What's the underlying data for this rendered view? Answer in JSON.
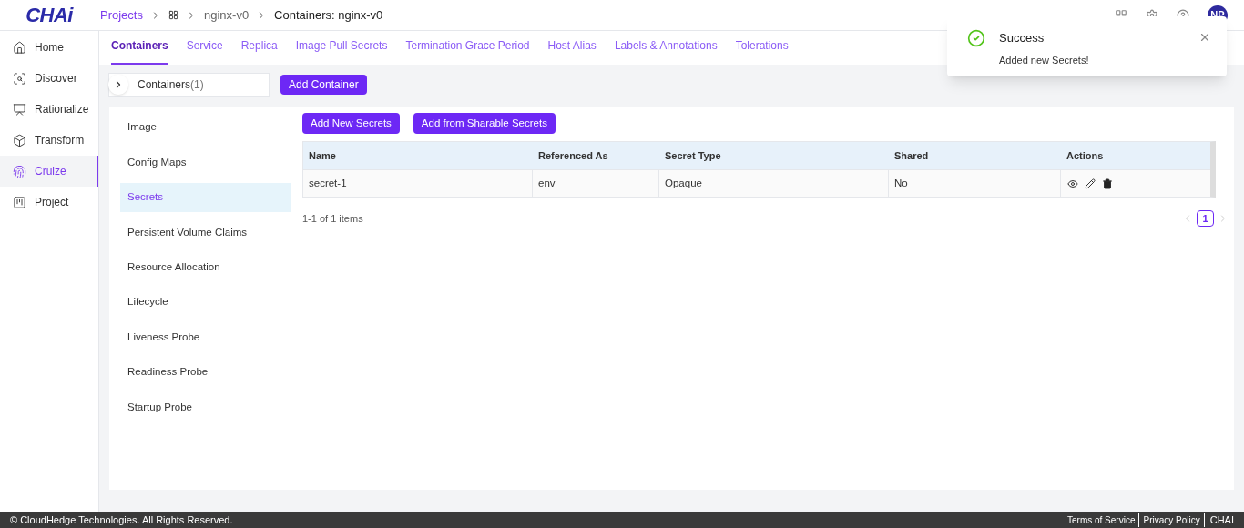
{
  "logo": "CHAi",
  "breadcrumb": [
    {
      "label": "Projects",
      "kind": "link"
    },
    {
      "kind": "grid"
    },
    {
      "label": "nginx-v0",
      "kind": "plain"
    },
    {
      "label": "Containers: nginx-v0",
      "kind": "current"
    }
  ],
  "avatar": "NP",
  "sidebar": [
    {
      "label": "Home",
      "selected": false
    },
    {
      "label": "Discover",
      "selected": false
    },
    {
      "label": "Rationalize",
      "selected": false
    },
    {
      "label": "Transform",
      "selected": false
    },
    {
      "label": "Cruize",
      "selected": true
    },
    {
      "label": "Project",
      "selected": false
    }
  ],
  "tabs": [
    {
      "label": "Containers",
      "selected": true
    },
    {
      "label": "Service",
      "selected": false
    },
    {
      "label": "Replica",
      "selected": false
    },
    {
      "label": "Image Pull Secrets",
      "selected": false
    },
    {
      "label": "Termination Grace Period",
      "selected": false
    },
    {
      "label": "Host Alias",
      "selected": false
    },
    {
      "label": "Labels & Annotations",
      "selected": false
    },
    {
      "label": "Tolerations",
      "selected": false
    }
  ],
  "container_selector": {
    "label": "Containers",
    "count": "(1)"
  },
  "add_container": "Add Container",
  "sections": [
    {
      "label": "Image",
      "selected": false
    },
    {
      "label": "Config Maps",
      "selected": false
    },
    {
      "label": "Secrets",
      "selected": true
    },
    {
      "label": "Persistent Volume Claims",
      "selected": false
    },
    {
      "label": "Resource Allocation",
      "selected": false
    },
    {
      "label": "Lifecycle",
      "selected": false
    },
    {
      "label": "Liveness Probe",
      "selected": false
    },
    {
      "label": "Readiness Probe",
      "selected": false
    },
    {
      "label": "Startup Probe",
      "selected": false
    }
  ],
  "actions": [
    "Add New Secrets",
    "Add from Sharable Secrets"
  ],
  "table": {
    "columns": [
      "Name",
      "Referenced As",
      "Secret Type",
      "Shared",
      "Actions"
    ],
    "rows": [
      {
        "cells": [
          "secret-1",
          "env",
          "Opaque",
          "No"
        ]
      }
    ]
  },
  "pagination": {
    "summary": "1-1 of 1 items",
    "pages": [
      {
        "label": "1",
        "selected": true
      }
    ]
  },
  "toast": {
    "title": "Success",
    "message": "Added new Secrets!"
  },
  "footer": {
    "copyright": "© CloudHedge Technologies. All Rights Reserved.",
    "links": [
      "Terms of Service",
      "Privacy Policy",
      "CHAI"
    ]
  }
}
